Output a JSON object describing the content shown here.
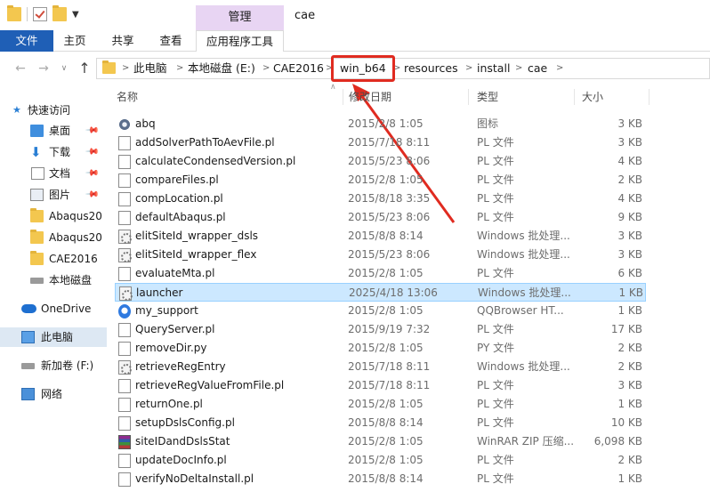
{
  "window": {
    "context_tab": "管理",
    "title": "cae"
  },
  "ribbon": {
    "file": "文件",
    "home": "主页",
    "share": "共享",
    "view": "查看",
    "app_tools": "应用程序工具"
  },
  "address": {
    "crumbs": [
      "此电脑",
      "本地磁盘 (E:)",
      "CAE2016",
      "win_b64",
      "resources",
      "install",
      "cae"
    ],
    "highlighted": "win_b64"
  },
  "nav_pane": {
    "quick_access": "快速访问",
    "desktop": "桌面",
    "downloads": "下载",
    "documents": "文档",
    "pictures": "图片",
    "abaqus1": "Abaqus20",
    "abaqus2": "Abaqus20",
    "cae2016": "CAE2016",
    "local_disk": "本地磁盘",
    "onedrive": "OneDrive",
    "this_pc": "此电脑",
    "new_volume": "新加卷 (F:)",
    "network": "网络"
  },
  "columns": {
    "name": "名称",
    "date": "修改日期",
    "type": "类型",
    "size": "大小"
  },
  "files": [
    {
      "name": "abq",
      "date": "2015/2/8 1:05",
      "type": "图标",
      "size": "3 KB",
      "icon": "gear-icon"
    },
    {
      "name": "addSolverPathToAevFile.pl",
      "date": "2015/7/18 8:11",
      "type": "PL 文件",
      "size": "3 KB",
      "icon": "document-icon"
    },
    {
      "name": "calculateCondensedVersion.pl",
      "date": "2015/5/23 8:06",
      "type": "PL 文件",
      "size": "4 KB",
      "icon": "document-icon"
    },
    {
      "name": "compareFiles.pl",
      "date": "2015/2/8 1:05",
      "type": "PL 文件",
      "size": "2 KB",
      "icon": "document-icon"
    },
    {
      "name": "compLocation.pl",
      "date": "2015/8/18 3:35",
      "type": "PL 文件",
      "size": "4 KB",
      "icon": "document-icon"
    },
    {
      "name": "defaultAbaqus.pl",
      "date": "2015/5/23 8:06",
      "type": "PL 文件",
      "size": "9 KB",
      "icon": "document-icon"
    },
    {
      "name": "elitSiteId_wrapper_dsls",
      "date": "2015/8/8 8:14",
      "type": "Windows 批处理...",
      "size": "3 KB",
      "icon": "batch-file-icon"
    },
    {
      "name": "elitSiteId_wrapper_flex",
      "date": "2015/5/23 8:06",
      "type": "Windows 批处理...",
      "size": "3 KB",
      "icon": "batch-file-icon"
    },
    {
      "name": "evaluateMta.pl",
      "date": "2015/2/8 1:05",
      "type": "PL 文件",
      "size": "6 KB",
      "icon": "document-icon"
    },
    {
      "name": "launcher",
      "date": "2025/4/18 13:06",
      "type": "Windows 批处理...",
      "size": "1 KB",
      "icon": "batch-file-icon",
      "selected": true
    },
    {
      "name": "my_support",
      "date": "2015/2/8 1:05",
      "type": "QQBrowser HT...",
      "size": "1 KB",
      "icon": "browser-icon"
    },
    {
      "name": "QueryServer.pl",
      "date": "2015/9/19 7:32",
      "type": "PL 文件",
      "size": "17 KB",
      "icon": "document-icon"
    },
    {
      "name": "removeDir.py",
      "date": "2015/2/8 1:05",
      "type": "PY 文件",
      "size": "2 KB",
      "icon": "document-icon"
    },
    {
      "name": "retrieveRegEntry",
      "date": "2015/7/18 8:11",
      "type": "Windows 批处理...",
      "size": "2 KB",
      "icon": "batch-file-icon"
    },
    {
      "name": "retrieveRegValueFromFile.pl",
      "date": "2015/7/18 8:11",
      "type": "PL 文件",
      "size": "3 KB",
      "icon": "document-icon"
    },
    {
      "name": "returnOne.pl",
      "date": "2015/2/8 1:05",
      "type": "PL 文件",
      "size": "1 KB",
      "icon": "document-icon"
    },
    {
      "name": "setupDslsConfig.pl",
      "date": "2015/8/8 8:14",
      "type": "PL 文件",
      "size": "10 KB",
      "icon": "document-icon"
    },
    {
      "name": "siteIDandDslsStat",
      "date": "2015/2/8 1:05",
      "type": "WinRAR ZIP 压缩...",
      "size": "6,098 KB",
      "icon": "winrar-archive-icon"
    },
    {
      "name": "updateDocInfo.pl",
      "date": "2015/2/8 1:05",
      "type": "PL 文件",
      "size": "2 KB",
      "icon": "document-icon"
    },
    {
      "name": "verifyNoDeltaInstall.pl",
      "date": "2015/8/8 8:14",
      "type": "PL 文件",
      "size": "1 KB",
      "icon": "document-icon"
    }
  ],
  "colors": {
    "file_tab": "#1f5fb6",
    "context_tab": "#e8d5f3",
    "selection": "#cce8ff",
    "annotation": "#e02b20"
  }
}
